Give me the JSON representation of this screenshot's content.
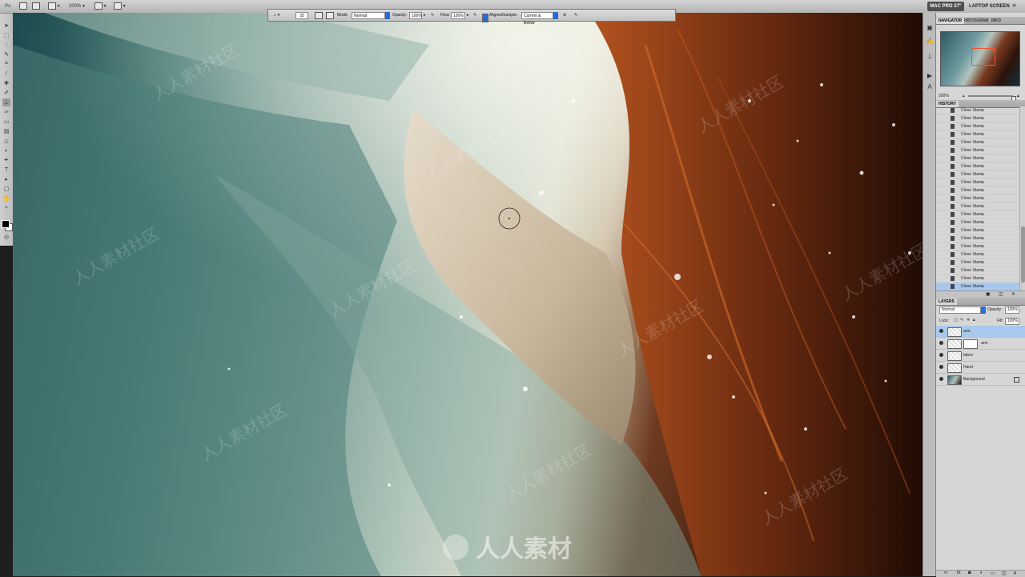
{
  "app_bar": {
    "app_glyph": "Ps",
    "zoom": "200%",
    "workspace_active": "MAC PRO 27\"",
    "workspace_other": "LAPTOP SCREEN",
    "more": "»"
  },
  "options_bar": {
    "brush_size": "35",
    "mode_label": "Mode:",
    "mode_value": "Normal",
    "opacity_label": "Opacity:",
    "opacity_value": "100%",
    "flow_label": "Flow:",
    "flow_value": "100%",
    "aligned_label": "Aligned",
    "sample_label": "Sample:",
    "sample_value": "Current & Below"
  },
  "canvas": {
    "watermark_text": "人人素材社区",
    "logo_text": "人人素材"
  },
  "panels": {
    "top_tabs": [
      "NAVIGATOR",
      "HISTOGRAM",
      "INFO"
    ],
    "navigator_zoom": "200%",
    "history_tab": "HISTORY",
    "history_items": [
      "Clone Stamp",
      "Clone Stamp",
      "Clone Stamp",
      "Clone Stamp",
      "Clone Stamp",
      "Clone Stamp",
      "Clone Stamp",
      "Clone Stamp",
      "Clone Stamp",
      "Clone Stamp",
      "Clone Stamp",
      "Clone Stamp",
      "Clone Stamp",
      "Clone Stamp",
      "Clone Stamp",
      "Clone Stamp",
      "Clone Stamp",
      "Clone Stamp",
      "Clone Stamp",
      "Clone Stamp",
      "Clone Stamp",
      "Clone Stamp",
      "Clone Stamp"
    ],
    "history_selected_index": 22,
    "layers_tab": "LAYERS",
    "blend_mode": "Normal",
    "opacity_label": "Opacity:",
    "opacity_value": "100%",
    "lock_label": "Lock:",
    "fill_label": "Fill:",
    "fill_value": "100%",
    "layers": [
      {
        "name": "arm",
        "selected": true,
        "mask": false,
        "locked": false
      },
      {
        "name": "arm",
        "selected": false,
        "mask": true,
        "locked": false
      },
      {
        "name": "fabric",
        "selected": false,
        "mask": false,
        "locked": false
      },
      {
        "name": "Hand",
        "selected": false,
        "mask": false,
        "locked": false
      },
      {
        "name": "Background",
        "selected": false,
        "mask": false,
        "locked": true
      }
    ]
  },
  "colors": {
    "selection_blue": "#a9c9ec",
    "accent_blue": "#2a6ad8",
    "workspace_dark": "#4f4f4f"
  }
}
